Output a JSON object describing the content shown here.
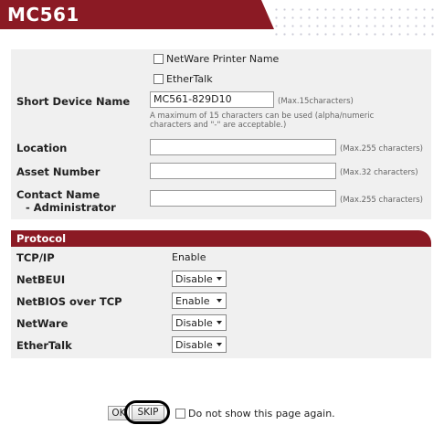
{
  "header": {
    "title": "MC561"
  },
  "options": {
    "netware_printer_name": "NetWare Printer Name",
    "ethertalk": "EtherTalk"
  },
  "fields": {
    "short_device_name": {
      "label": "Short Device Name",
      "value": "MC561-829D10",
      "hint": "(Max.15characters)",
      "note": "A maximum of 15 characters can be used (alpha/numeric characters and \"-\" are acceptable.)"
    },
    "location": {
      "label": "Location",
      "value": "",
      "hint": "(Max.255 characters)"
    },
    "asset_number": {
      "label": "Asset Number",
      "value": "",
      "hint": "(Max.32 characters)"
    },
    "contact_name": {
      "label_line1": "Contact Name",
      "label_line2": "- Administrator",
      "value": "",
      "hint": "(Max.255 characters)"
    }
  },
  "protocol": {
    "header": "Protocol",
    "rows": [
      {
        "label": "TCP/IP",
        "value": "Enable"
      },
      {
        "label": "NetBEUI",
        "value": "Disable"
      },
      {
        "label": "NetBIOS over TCP",
        "value": "Enable"
      },
      {
        "label": "NetWare",
        "value": "Disable"
      },
      {
        "label": "EtherTalk",
        "value": "Disable"
      }
    ]
  },
  "footer": {
    "ok_label": "OK",
    "skip_label": "SKIP",
    "no_show_label": "Do not show this page again."
  }
}
